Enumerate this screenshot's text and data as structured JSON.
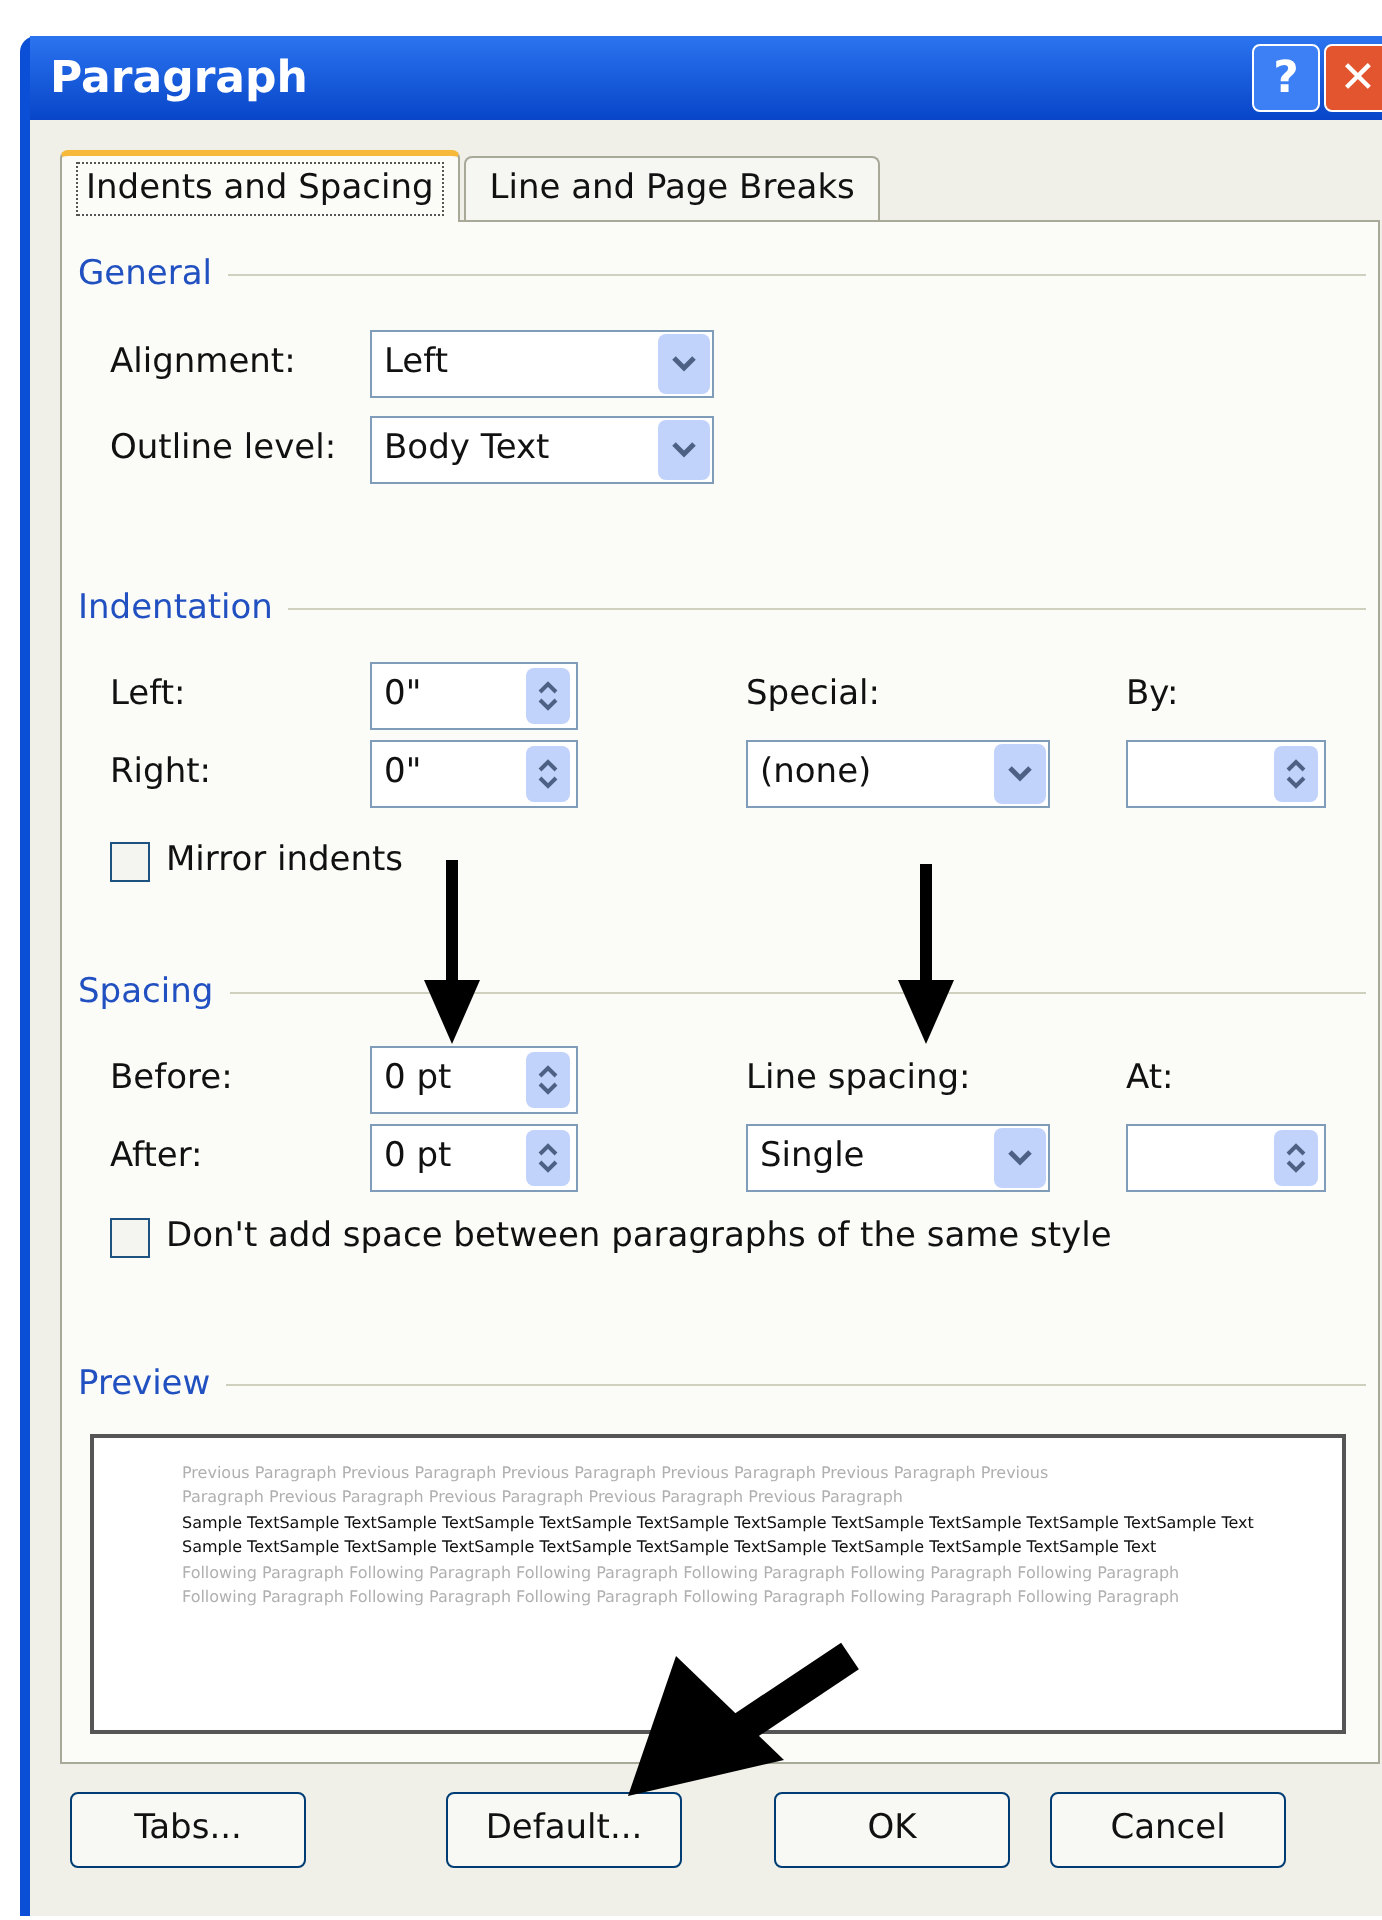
{
  "window": {
    "title": "Paragraph",
    "title_buttons": [
      {
        "kind": "help",
        "label": "?"
      },
      {
        "kind": "close",
        "label": "✕"
      }
    ]
  },
  "tabs": [
    {
      "label": "Indents and Spacing",
      "selected": true
    },
    {
      "label": "Line and Page Breaks",
      "selected": false
    }
  ],
  "general": {
    "heading": "General",
    "fields": [
      {
        "label": "Alignment:",
        "value": "Left",
        "kind": "combo"
      },
      {
        "label": "Outline level:",
        "value": "Body Text",
        "kind": "combo"
      }
    ]
  },
  "indentation": {
    "heading": "Indentation",
    "left": [
      {
        "label": "Left:",
        "value": "0\"",
        "kind": "spin"
      },
      {
        "label": "Right:",
        "value": "0\"",
        "kind": "spin"
      }
    ],
    "special": {
      "label": "Special:",
      "value": "(none)"
    },
    "by": {
      "label": "By:"
    },
    "mirror": {
      "label": "Mirror indents",
      "checked": false
    }
  },
  "spacing": {
    "heading": "Spacing",
    "left": [
      {
        "label": "Before:",
        "value": "0 pt",
        "kind": "spin"
      },
      {
        "label": "After:",
        "value": "0 pt",
        "kind": "spin"
      }
    ],
    "line_spacing": {
      "label": "Line spacing:",
      "value": "Single"
    },
    "at": {
      "label": "At:"
    },
    "dont_add": {
      "label": "Don't add space between paragraphs of the same style",
      "checked": false
    }
  },
  "preview": {
    "heading": "Preview",
    "previous": "Previous Paragraph Previous Paragraph Previous Paragraph Previous Paragraph Previous Paragraph Previous Paragraph Previous Paragraph Previous Paragraph Previous Paragraph Previous Paragraph",
    "sample": "Sample TextSample TextSample TextSample TextSample TextSample TextSample TextSample TextSample TextSample TextSample TextSample TextSample TextSample TextSample TextSample TextSample TextSample TextSample TextSample TextSample Text",
    "following": "Following Paragraph Following Paragraph Following Paragraph Following Paragraph Following Paragraph Following Paragraph Following Paragraph Following Paragraph Following Paragraph Following Paragraph Following Paragraph Following Paragraph"
  },
  "buttons": [
    {
      "label": "Tabs..."
    },
    {
      "label": "Default..."
    },
    {
      "label": "OK"
    },
    {
      "label": "Cancel"
    }
  ]
}
